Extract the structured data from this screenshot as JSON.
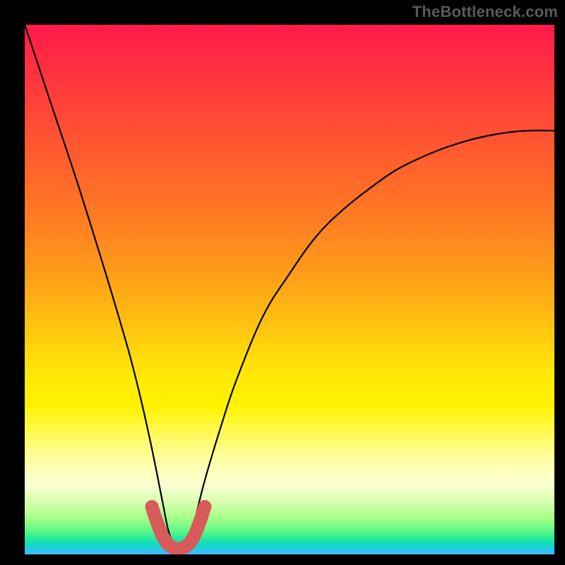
{
  "watermark": "TheBottleneck.com",
  "colors": {
    "page_bg": "#000000",
    "curve_main": "#000000",
    "curve_highlight": "#d85a5a",
    "watermark": "#5a5a5a"
  },
  "chart_data": {
    "type": "line",
    "title": "",
    "xlabel": "",
    "ylabel": "",
    "xlim": [
      0,
      100
    ],
    "ylim": [
      0,
      100
    ],
    "annotations": [],
    "series": [
      {
        "name": "bottleneck-curve",
        "x": [
          0,
          5,
          10,
          15,
          18,
          20,
          22,
          24,
          26,
          27,
          28,
          29,
          30,
          31,
          32,
          34,
          37,
          40,
          45,
          50,
          55,
          60,
          65,
          70,
          75,
          80,
          85,
          90,
          95,
          100
        ],
        "values": [
          100,
          85,
          70,
          54,
          44,
          37,
          29,
          20,
          10,
          5,
          2,
          1,
          1,
          2,
          6,
          14,
          24,
          33,
          45,
          53,
          60,
          65,
          69,
          72.5,
          75,
          77,
          78.5,
          79.5,
          80,
          80
        ]
      },
      {
        "name": "optimal-region-highlight",
        "x": [
          24,
          25,
          26,
          27,
          28,
          29,
          30,
          31,
          32,
          33,
          34
        ],
        "values": [
          9,
          6,
          3.5,
          2,
          1.3,
          1,
          1.3,
          2,
          3.5,
          6,
          9
        ]
      }
    ]
  }
}
